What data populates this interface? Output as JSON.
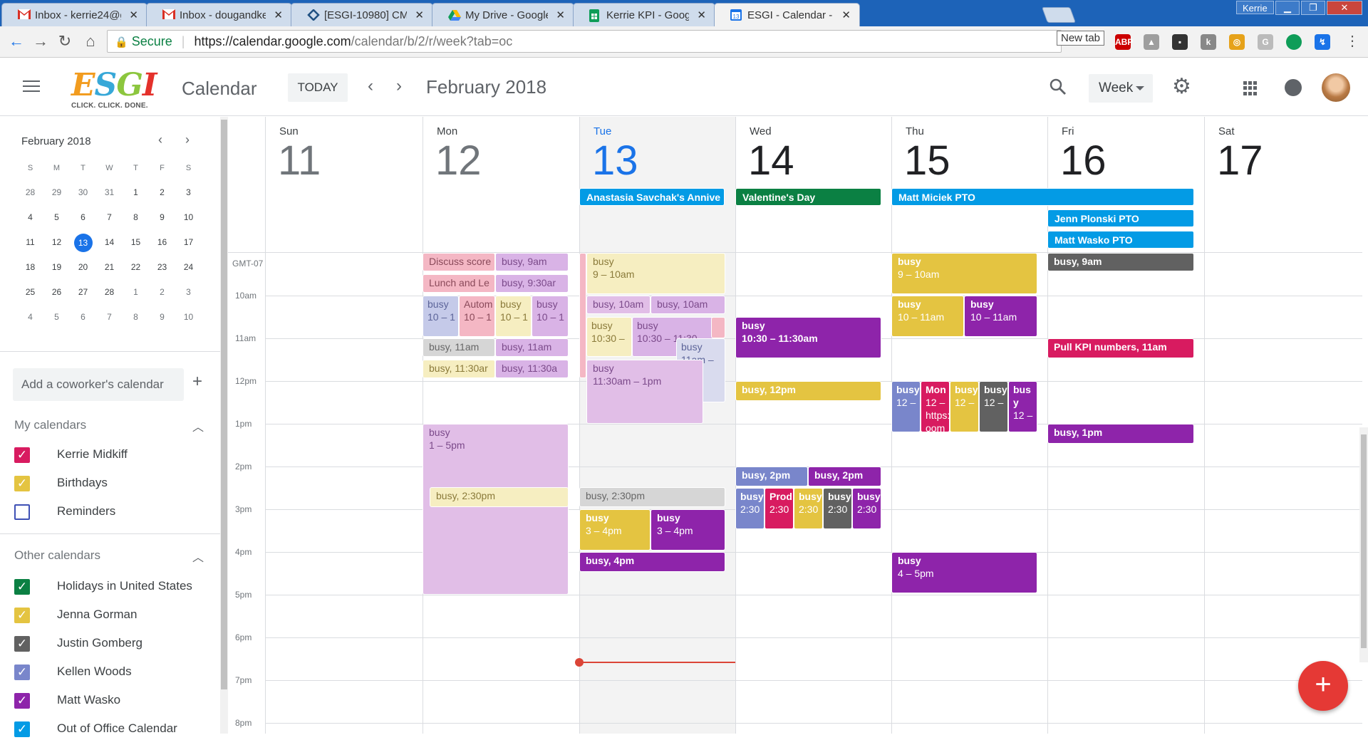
{
  "browser": {
    "tabs": [
      {
        "label": "Inbox - kerrie24@gmail.c",
        "icon": "gmail-icon",
        "active": false
      },
      {
        "label": "Inbox - dougandkerrie@",
        "icon": "gmail-icon",
        "active": false
      },
      {
        "label": "[ESGI-10980] CMT Payme",
        "icon": "jira-icon",
        "active": false
      },
      {
        "label": "My Drive - Google Drive",
        "icon": "drive-icon",
        "active": false
      },
      {
        "label": "Kerrie KPI - Google Shee",
        "icon": "sheets-icon",
        "active": false
      },
      {
        "label": "ESGI - Calendar - Week o",
        "icon": "calendar-icon",
        "active": true
      }
    ],
    "profile": "Kerrie",
    "tooltip": "New tab",
    "address": {
      "secure_label": "Secure",
      "url_host": "https://calendar.google.com",
      "url_path": "/calendar/b/2/r/week?tab=oc"
    }
  },
  "header": {
    "logo_text": "ESGI",
    "logo_tagline": "CLICK. CLICK. DONE.",
    "app_title": "Calendar",
    "today_label": "TODAY",
    "month_title": "February 2018",
    "view_label": "Week"
  },
  "sidebar": {
    "mini_month": "February 2018",
    "dow": [
      "S",
      "M",
      "T",
      "W",
      "T",
      "F",
      "S"
    ],
    "weeks": [
      [
        "28",
        "29",
        "30",
        "31",
        "1",
        "2",
        "3"
      ],
      [
        "4",
        "5",
        "6",
        "7",
        "8",
        "9",
        "10"
      ],
      [
        "11",
        "12",
        "13",
        "14",
        "15",
        "16",
        "17"
      ],
      [
        "18",
        "19",
        "20",
        "21",
        "22",
        "23",
        "24"
      ],
      [
        "25",
        "26",
        "27",
        "28",
        "1",
        "2",
        "3"
      ],
      [
        "4",
        "5",
        "6",
        "7",
        "8",
        "9",
        "10"
      ]
    ],
    "add_coworker": "Add a coworker's calendar",
    "my_calendars_title": "My calendars",
    "my_calendars": [
      {
        "label": "Kerrie Midkiff",
        "color": "#d81b60",
        "checked": true
      },
      {
        "label": "Birthdays",
        "color": "#e4c441",
        "checked": true
      },
      {
        "label": "Reminders",
        "color": "#3f51b5",
        "checked": false
      }
    ],
    "other_calendars_title": "Other calendars",
    "other_calendars": [
      {
        "label": "Holidays in United States",
        "color": "#0b8043",
        "checked": true
      },
      {
        "label": "Jenna Gorman",
        "color": "#e4c441",
        "checked": true
      },
      {
        "label": "Justin Gomberg",
        "color": "#616161",
        "checked": true
      },
      {
        "label": "Kellen Woods",
        "color": "#7986cb",
        "checked": true
      },
      {
        "label": "Matt Wasko",
        "color": "#8e24aa",
        "checked": true
      },
      {
        "label": "Out of Office Calendar",
        "color": "#039be5",
        "checked": true
      }
    ]
  },
  "week": {
    "days": [
      {
        "dow": "Sun",
        "num": "11",
        "today": false
      },
      {
        "dow": "Mon",
        "num": "12",
        "today": false
      },
      {
        "dow": "Tue",
        "num": "13",
        "today": true
      },
      {
        "dow": "Wed",
        "num": "14",
        "today": false
      },
      {
        "dow": "Thu",
        "num": "15",
        "today": false
      },
      {
        "dow": "Fri",
        "num": "16",
        "today": false
      },
      {
        "dow": "Sat",
        "num": "17",
        "today": false
      }
    ],
    "timezone": "GMT-07",
    "time_labels": [
      "10am",
      "11am",
      "12pm",
      "1pm",
      "2pm",
      "3pm",
      "4pm",
      "5pm",
      "6pm",
      "7pm",
      "8pm"
    ],
    "all_day": [
      {
        "title": "Anastasia Savchak's Annive",
        "color": "#039be5"
      },
      {
        "title": "Valentine's Day",
        "color": "#0b8043"
      },
      {
        "title": "Matt Miciek PTO",
        "color": "#039be5"
      },
      {
        "title": "Jenn Plonski PTO",
        "color": "#039be5"
      },
      {
        "title": "Matt Wasko PTO",
        "color": "#039be5"
      }
    ],
    "events": [
      {
        "title": "Discuss score",
        "time": ""
      },
      {
        "title": "busy, 9am",
        "time": ""
      },
      {
        "title": "Lunch and Le",
        "time": ""
      },
      {
        "title": "busy, 9:30ar",
        "time": ""
      },
      {
        "title": "busy",
        "time": "10 – 1"
      },
      {
        "title": "Autom",
        "time": "10 – 1"
      },
      {
        "title": "busy",
        "time": "10 – 1"
      },
      {
        "title": "busy",
        "time": "10 – 1"
      },
      {
        "title": "busy, 11am",
        "time": ""
      },
      {
        "title": "busy, 11am",
        "time": ""
      },
      {
        "title": "busy, 11:30ar",
        "time": ""
      },
      {
        "title": "busy, 11:30a",
        "time": ""
      },
      {
        "title": "busy",
        "time": "1 – 5pm"
      },
      {
        "title": "busy, 2:30pm",
        "time": ""
      },
      {
        "title": "busy",
        "time": "9 – 10am"
      },
      {
        "title": "busy, 10am",
        "time": ""
      },
      {
        "title": "busy, 10am",
        "time": ""
      },
      {
        "title": "busy",
        "time": "10:30 –"
      },
      {
        "title": "busy",
        "time": "10:30 – 11:30"
      },
      {
        "title": "busy",
        "time": "11am –"
      },
      {
        "title": "busy",
        "time": "11:30am – 1pm"
      },
      {
        "title": "busy, 2:30pm",
        "time": ""
      },
      {
        "title": "busy",
        "time": "3 – 4pm"
      },
      {
        "title": "busy",
        "time": "3 – 4pm"
      },
      {
        "title": "busy, 4pm",
        "time": ""
      },
      {
        "title": "busy",
        "time": "10:30 – 11:30am"
      },
      {
        "title": "busy, 12pm",
        "time": ""
      },
      {
        "title": "busy, 2pm",
        "time": ""
      },
      {
        "title": "busy, 2pm",
        "time": ""
      },
      {
        "title": "busy",
        "time": "2:30"
      },
      {
        "title": "Prod",
        "time": "2:30"
      },
      {
        "title": "busy",
        "time": "2:30"
      },
      {
        "title": "busy",
        "time": "2:30"
      },
      {
        "title": "busy",
        "time": "2:30"
      },
      {
        "title": "busy",
        "time": "9 – 10am"
      },
      {
        "title": "busy",
        "time": "10 – 11am"
      },
      {
        "title": "busy",
        "time": "10 – 11am"
      },
      {
        "title": "busy",
        "time": "12 –"
      },
      {
        "title": "Mon",
        "time": "12 –"
      },
      {
        "title": "busy",
        "time": "12 –"
      },
      {
        "title": "busy",
        "time": "12 –"
      },
      {
        "title": "bus",
        "time": "y"
      },
      {
        "title": "busy",
        "time": "4 – 5pm"
      },
      {
        "title": "busy, 9am",
        "time": ""
      },
      {
        "title": "Pull KPI numbers, 11am",
        "time": ""
      },
      {
        "title": "busy, 1pm",
        "time": ""
      }
    ],
    "event_extras": {
      "mon_link": "https://",
      "mon_link2": "oom",
      "thu_time_12": "12 –"
    }
  },
  "colors": {
    "accent": "#1a73e8",
    "now_line": "#db4437",
    "fab": "#e53935"
  }
}
